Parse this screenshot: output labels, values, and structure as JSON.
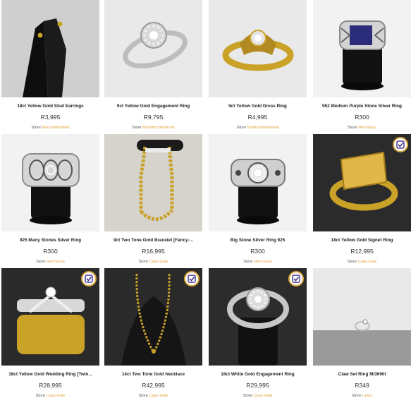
{
  "store_label": "Store",
  "products": [
    {
      "title": "18ct Yellow Gold Stud Earrings",
      "price": "R3,995",
      "store": "Maccarthesfield",
      "icon": "stud-earrings-icon",
      "verified": false
    },
    {
      "title": "9ct Yellow Gold Engagement Ring",
      "price": "R9,795",
      "store": "Brandtonneybrook",
      "icon": "engagement-ring-icon",
      "verified": false
    },
    {
      "title": "9ct Yellow Gold Dress Ring",
      "price": "R4,995",
      "store": "Brakbanknewpark",
      "icon": "dress-ring-icon",
      "verified": false
    },
    {
      "title": "952 Medium Purple Stone Silver Ring",
      "price": "R300",
      "store": "Hermanus",
      "icon": "purple-stone-ring-icon",
      "verified": false
    },
    {
      "title": "925 Many Stones Silver Ring",
      "price": "R300",
      "store": "Hermanus",
      "icon": "silver-ring-icon",
      "verified": false
    },
    {
      "title": "9ct Two Tone Gold Bracelet [Fancy-...",
      "price": "R16,995",
      "store": "Cape Gate",
      "icon": "bracelet-icon",
      "verified": false
    },
    {
      "title": "Big Stone Silver Ring 925",
      "price": "R300",
      "store": "Hermanus",
      "icon": "big-stone-ring-icon",
      "verified": false
    },
    {
      "title": "18ct Yellow Gold Signet Ring",
      "price": "R12,995",
      "store": "Cape Gate",
      "icon": "signet-ring-icon",
      "verified": true
    },
    {
      "title": "18ct Yellow Gold Wedding Ring [Twin...",
      "price": "R28,995",
      "store": "Cape Gate",
      "icon": "wedding-ring-icon",
      "verified": true
    },
    {
      "title": "14ct Two Tone Gold Necklace",
      "price": "R42,995",
      "store": "Cape Gate",
      "icon": "necklace-icon",
      "verified": true
    },
    {
      "title": "18ct White Gold Engagement Ring",
      "price": "R29,995",
      "store": "Cape Gate",
      "icon": "white-gold-ring-icon",
      "verified": true
    },
    {
      "title": "Claw Set Ring MI3690I",
      "price": "R349",
      "store": "Lewis",
      "icon": "claw-set-ring-icon",
      "verified": false
    }
  ],
  "colors": {
    "store_link": "#e3a13a",
    "gold": "#c9a227",
    "silver": "#c8c8c8",
    "display_black": "#111111",
    "badge_border": "#d8a43a",
    "badge_check": "#4b3b8f"
  }
}
